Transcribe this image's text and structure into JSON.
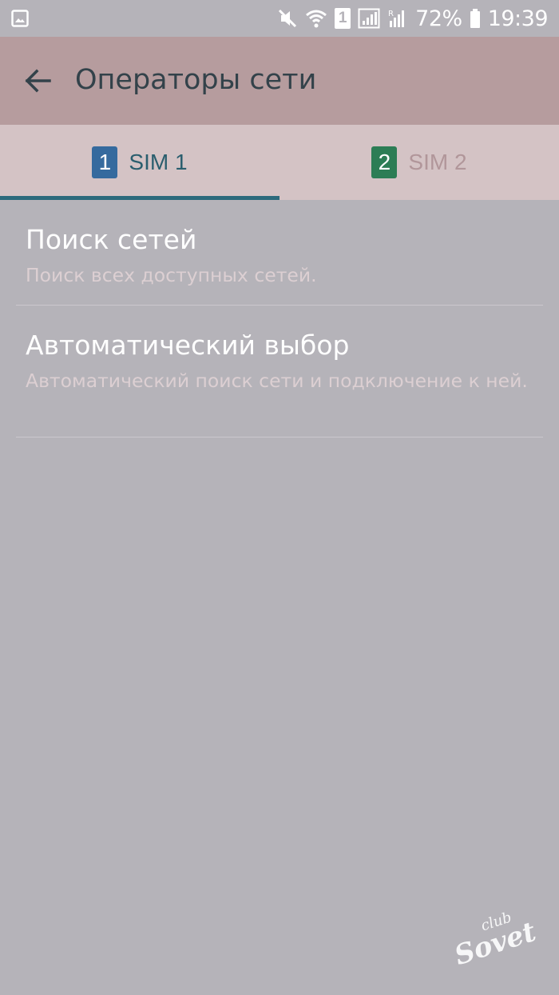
{
  "status_bar": {
    "battery_percent": "72%",
    "time": "19:39",
    "sim_slot_label": "1",
    "icons": [
      "gallery-icon",
      "mute-icon",
      "wifi-icon",
      "sim1-icon",
      "signal-icon",
      "signal-roaming-icon",
      "battery-icon"
    ]
  },
  "app_bar": {
    "title": "Операторы сети",
    "back_icon": "arrow-left-icon"
  },
  "tabs": [
    {
      "number": "1",
      "label": "SIM 1",
      "selected": true,
      "badge_color": "#356a9e"
    },
    {
      "number": "2",
      "label": "SIM 2",
      "selected": false,
      "badge_color": "#2c7d55"
    }
  ],
  "list": [
    {
      "title": "Поиск сетей",
      "subtitle": "Поиск всех доступных сетей."
    },
    {
      "title": "Автоматический выбор",
      "subtitle": "Автоматический поиск сети и подключение к ней."
    }
  ],
  "watermark": {
    "line1": "club",
    "line2": "Sovet"
  },
  "colors": {
    "background": "#b5b3b9",
    "app_bar": "#b69c9e",
    "tabs_bar": "#d4c3c5",
    "tab_indicator": "#2c6a7c",
    "title_text": "#33424a"
  }
}
